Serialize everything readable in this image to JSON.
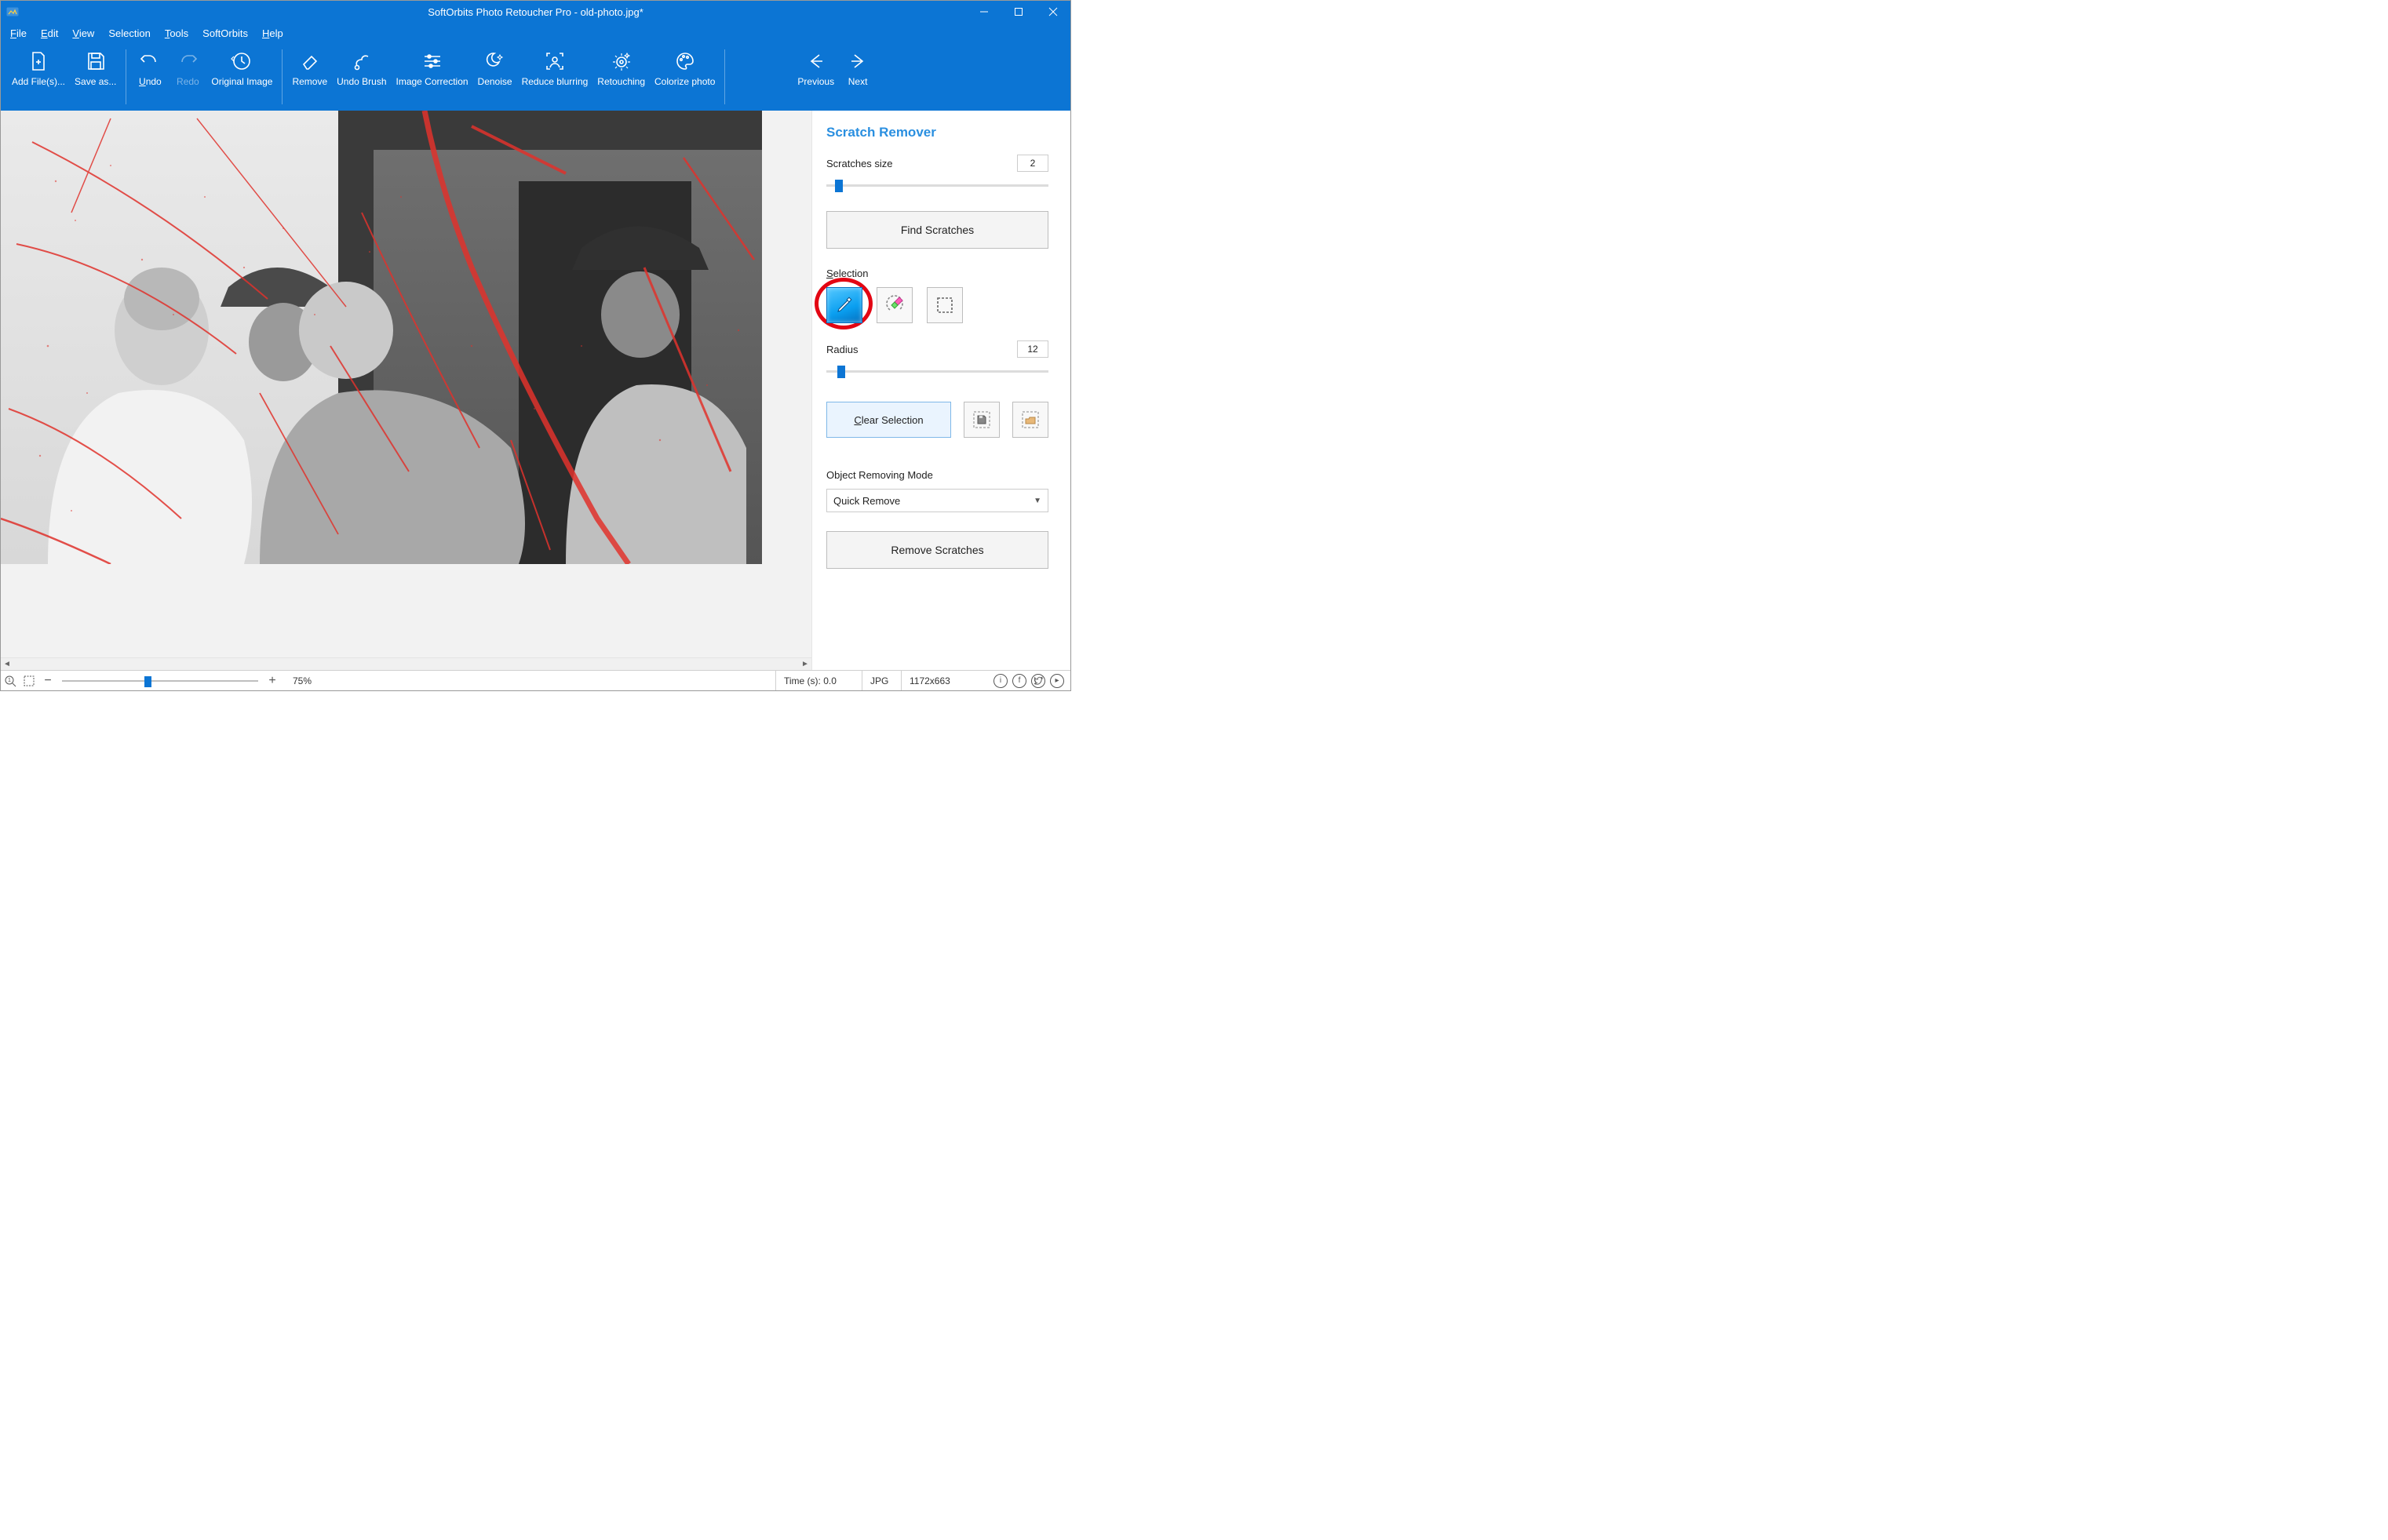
{
  "titlebar": {
    "title": "SoftOrbits Photo Retoucher Pro - old-photo.jpg*"
  },
  "menu": {
    "file": "File",
    "edit": "Edit",
    "view": "View",
    "selection": "Selection",
    "tools": "Tools",
    "softorbits": "SoftOrbits",
    "help": "Help"
  },
  "ribbon": {
    "add_files": "Add File(s)...",
    "save_as": "Save as...",
    "undo": "Undo",
    "redo": "Redo",
    "original_image": "Original Image",
    "remove": "Remove",
    "undo_brush": "Undo Brush",
    "image_correction": "Image Correction",
    "denoise": "Denoise",
    "reduce_blurring": "Reduce blurring",
    "retouching": "Retouching",
    "colorize_photo": "Colorize photo",
    "previous": "Previous",
    "next": "Next"
  },
  "side": {
    "heading": "Scratch Remover",
    "scratches_size_label": "Scratches size",
    "scratches_size_value": "2",
    "find_scratches": "Find Scratches",
    "selection_label": "Selection",
    "radius_label": "Radius",
    "radius_value": "12",
    "clear_selection": "Clear Selection",
    "object_removing_mode_label": "Object Removing Mode",
    "object_removing_mode_value": "Quick Remove",
    "remove_scratches": "Remove Scratches"
  },
  "status": {
    "zoom": "75%",
    "time": "Time (s): 0.0",
    "format": "JPG",
    "dimensions": "1172x663"
  }
}
